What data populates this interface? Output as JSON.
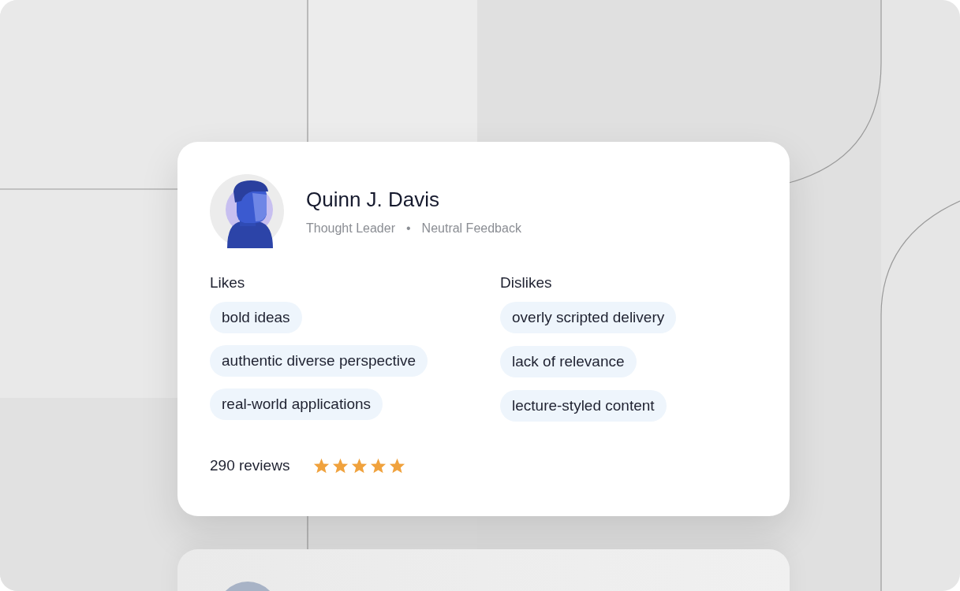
{
  "profile": {
    "name": "Quinn J. Davis",
    "role": "Thought Leader",
    "separator": "•",
    "sentiment": "Neutral Feedback"
  },
  "likes": {
    "heading": "Likes",
    "items": [
      "bold ideas",
      "authentic diverse perspective",
      "real-world applications"
    ]
  },
  "dislikes": {
    "heading": "Dislikes",
    "items": [
      "overly scripted delivery",
      "lack of relevance",
      "lecture-styled content"
    ]
  },
  "footer": {
    "reviews": "290 reviews",
    "stars": 5
  }
}
